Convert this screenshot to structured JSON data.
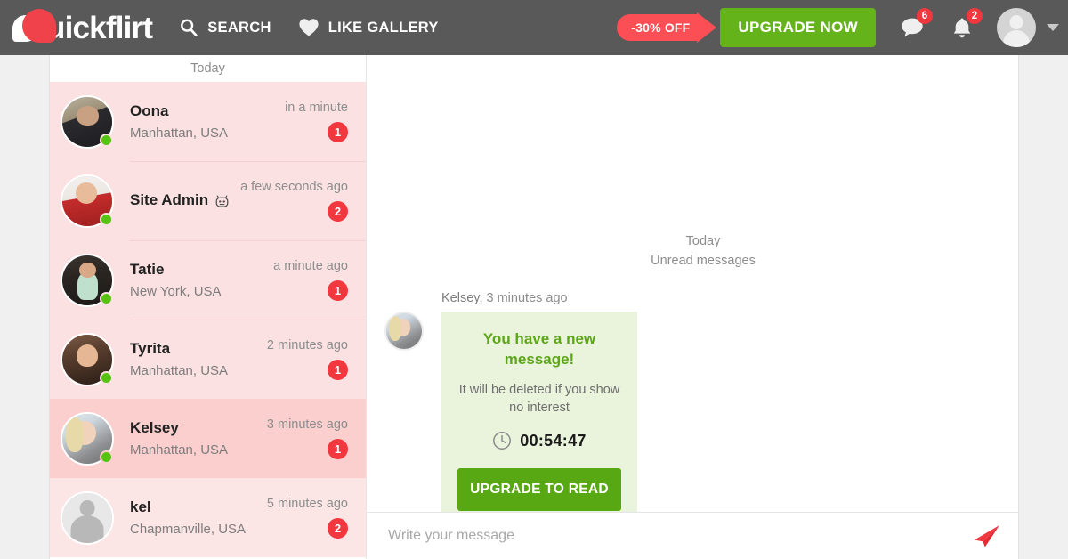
{
  "header": {
    "logo_text": "uickflirt",
    "nav": [
      {
        "label": "SEARCH",
        "icon": "search-icon"
      },
      {
        "label": "LIKE GALLERY",
        "icon": "heart-icon"
      }
    ],
    "discount_badge": "-30% OFF",
    "upgrade_button": "UPGRADE NOW",
    "messages_badge": "6",
    "notifications_badge": "2"
  },
  "sidebar": {
    "day_label": "Today",
    "conversations": [
      {
        "name": "Oona",
        "location": "Manhattan, USA",
        "time": "in a minute",
        "unread": "1",
        "online": true,
        "bot": false,
        "state": "normal",
        "avatar": "ph-1"
      },
      {
        "name": "Site Admin",
        "location": "",
        "time": "a few seconds ago",
        "unread": "2",
        "online": true,
        "bot": true,
        "state": "normal",
        "avatar": "ph-2"
      },
      {
        "name": "Tatie",
        "location": "New York, USA",
        "time": "a minute ago",
        "unread": "1",
        "online": true,
        "bot": false,
        "state": "normal",
        "avatar": "ph-3"
      },
      {
        "name": "Tyrita",
        "location": "Manhattan, USA",
        "time": "2 minutes ago",
        "unread": "1",
        "online": true,
        "bot": false,
        "state": "normal",
        "avatar": "ph-4"
      },
      {
        "name": "Kelsey",
        "location": "Manhattan, USA",
        "time": "3 minutes ago",
        "unread": "1",
        "online": true,
        "bot": false,
        "state": "selected",
        "avatar": "ph-5"
      },
      {
        "name": "kel",
        "location": "Chapmanville, USA",
        "time": "5 minutes ago",
        "unread": "2",
        "online": false,
        "bot": false,
        "state": "faded",
        "avatar": "ph-6"
      }
    ]
  },
  "chat": {
    "day_label": "Today",
    "unread_label": "Unread messages",
    "message": {
      "author": "Kelsey,",
      "time": "3 minutes ago",
      "card": {
        "title": "You have a new message!",
        "subtitle": "It will be deleted if you show no interest",
        "countdown": "00:54:47",
        "button": "UPGRADE TO READ"
      }
    },
    "composer_placeholder": "Write your message"
  },
  "colors": {
    "header_bg": "#595959",
    "brand_red": "#f0424a",
    "accent_green": "#64b31b",
    "badge_red": "#f2373f",
    "row_pink": "#fbe1e1",
    "row_pink_selected": "#fccfcf",
    "card_green_bg": "#eaf4dc"
  }
}
